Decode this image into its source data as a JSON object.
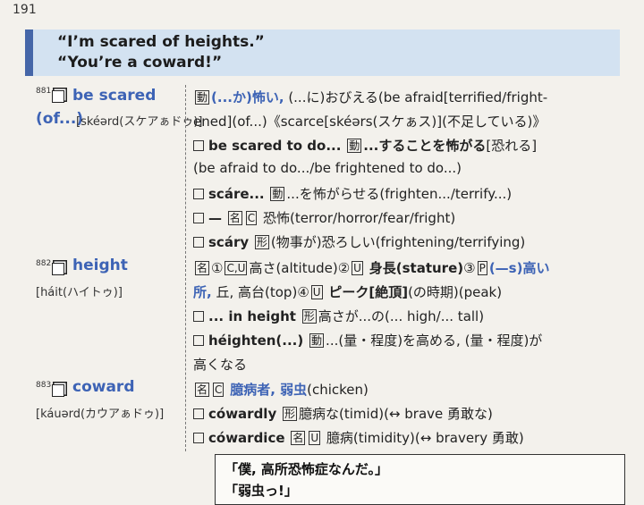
{
  "page_number": "191",
  "header": {
    "line1": "“I’m scared of heights.”",
    "line2": "“You’re a coward!”"
  },
  "entries": [
    {
      "number": "881",
      "headword_1": "be scared",
      "headword_2": "(of...)",
      "pronunciation": "[skéərd(スケアぁドゥ)]",
      "lines": [
        {
          "pos": "動",
          "main": "(...か)怖い,",
          "rest": "(...に)おびえる(be afraid[terrified/fright-"
        },
        {
          "text": "ened](of...)《scarce[skéərs(スケぁス)](不足している)》"
        },
        {
          "phrase": "be scared to do...",
          "pos": "動",
          "main": "...することを怖がる",
          "rest": "[恐れる]"
        },
        {
          "text": "(be afraid to do.../be frightened to do...)"
        },
        {
          "phrase": "scáre...",
          "pos": "動",
          "rest": "...を怖がらせる(frighten.../terrify...)"
        },
        {
          "phrase": "—",
          "pos": "名",
          "pos2": "C",
          "rest": "恐怖(terror/horror/fear/fright)"
        },
        {
          "phrase": "scáry",
          "pos": "形",
          "rest": "(物事が)恐ろしい(frightening/terrifying)"
        }
      ]
    },
    {
      "number": "882",
      "headword_1": "height",
      "pronunciation": "[háit(ハイトゥ)]",
      "lines": [
        {
          "pos": "名",
          "s1": "①",
          "t1": "C,U",
          "r1": "高さ(altitude)",
          "s2": "②",
          "t2": "U",
          "r2": "身長(stature)",
          "s3": "③",
          "t3": "P",
          "r3": "(—s)高い"
        },
        {
          "cont": "所,",
          "rest": "丘, 高台(top)",
          "s4": "④",
          "t4": "U",
          "b4": "ピーク[絶頂]",
          "r4": "(の時期)(peak)"
        },
        {
          "phrase": "... in height",
          "pos": "形",
          "rest": "高さが...の(... high/... tall)"
        },
        {
          "phrase": "héighten(...)",
          "pos": "動",
          "rest": "...(量・程度)を高める, (量・程度)が"
        },
        {
          "text": "高くなる"
        }
      ]
    },
    {
      "number": "883",
      "headword_1": "coward",
      "pronunciation": "[káuərd(カウアぁドゥ)]",
      "lines": [
        {
          "pos": "名",
          "pos2": "C",
          "main": "臆病者, 弱虫",
          "rest": "(chicken)"
        },
        {
          "phrase": "cówardly",
          "pos": "形",
          "rest": "臆病な(timid)(↔ brave 勇敢な)"
        },
        {
          "phrase": "cówardice",
          "pos": "名",
          "pos2": "U",
          "rest": "臆病(timidity)(↔ bravery 勇敢)"
        }
      ]
    }
  ],
  "dialogue": {
    "line1": "「僕, 高所恐怖症なんだ。」",
    "line2": "「弱虫っ!」"
  }
}
